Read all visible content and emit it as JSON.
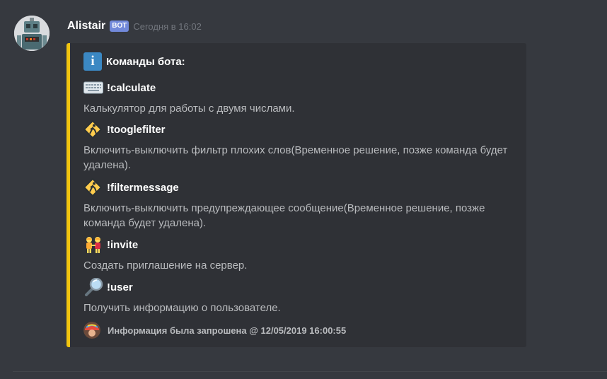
{
  "message": {
    "author": "Alistair",
    "bot_tag": "BOT",
    "timestamp": "Сегодня в 16:02",
    "avatar_icon": "robot-avatar"
  },
  "embed": {
    "accent_color": "#f1c40f",
    "title": "Команды бота:",
    "title_icon": "information-icon",
    "commands": [
      {
        "name": "!calculate",
        "icon": "keyboard-icon",
        "description": "Калькулятор для работы с двумя числами."
      },
      {
        "name": "!tooglefilter",
        "icon": "construction-sign-icon",
        "description": "Включить-выключить фильтр плохих слов(Временное решение, позже команда будет удалена)."
      },
      {
        "name": "!filtermessage",
        "icon": "construction-sign-icon",
        "description": "Включить-выключить предупреждающее сообщение(Временное решение, позже команда будет удалена)."
      },
      {
        "name": "!invite",
        "icon": "people-holding-hands-icon",
        "description": "Создать приглашение на сервер."
      },
      {
        "name": "!user",
        "icon": "magnifying-glass-icon",
        "description": "Получить информацию о пользователе."
      }
    ],
    "footer": {
      "text": "Информация была запрошена @ 12/05/2019 16:00:55",
      "icon": "requester-avatar"
    }
  }
}
